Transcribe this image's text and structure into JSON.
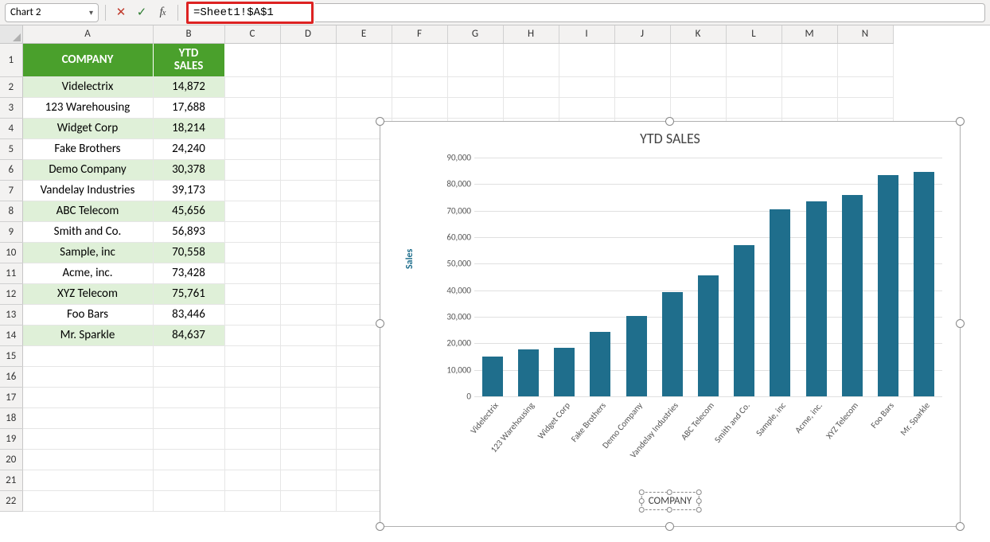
{
  "formula_bar": {
    "namebox": "Chart 2",
    "formula": "=Sheet1!$A$1"
  },
  "columns": [
    "A",
    "B",
    "C",
    "D",
    "E",
    "F",
    "G",
    "H",
    "I",
    "J",
    "K",
    "L",
    "M",
    "N"
  ],
  "table": {
    "headers": {
      "col1": "COMPANY",
      "col2": "YTD SALES"
    },
    "rows": [
      {
        "company": "Videlectrix",
        "sales": "14,872"
      },
      {
        "company": "123 Warehousing",
        "sales": "17,688"
      },
      {
        "company": "Widget Corp",
        "sales": "18,214"
      },
      {
        "company": "Fake Brothers",
        "sales": "24,240"
      },
      {
        "company": "Demo Company",
        "sales": "30,378"
      },
      {
        "company": "Vandelay Industries",
        "sales": "39,173"
      },
      {
        "company": "ABC Telecom",
        "sales": "45,656"
      },
      {
        "company": "Smith and Co.",
        "sales": "56,893"
      },
      {
        "company": "Sample, inc",
        "sales": "70,558"
      },
      {
        "company": "Acme, inc.",
        "sales": "73,428"
      },
      {
        "company": "XYZ Telecom",
        "sales": "75,761"
      },
      {
        "company": "Foo Bars",
        "sales": "83,446"
      },
      {
        "company": "Mr. Sparkle",
        "sales": "84,637"
      }
    ]
  },
  "chart_data": {
    "type": "bar",
    "title": "YTD SALES",
    "ylabel": "Sales",
    "legend": "COMPANY",
    "ylim": [
      0,
      90000
    ],
    "yticks": [
      "0",
      "10,000",
      "20,000",
      "30,000",
      "40,000",
      "50,000",
      "60,000",
      "70,000",
      "80,000",
      "90,000"
    ],
    "categories": [
      "Videlectrix",
      "123 Warehousing",
      "Widget Corp",
      "Fake Brothers",
      "Demo Company",
      "Vandelay Industries",
      "ABC Telecom",
      "Smith and Co.",
      "Sample, inc",
      "Acme, inc.",
      "XYZ Telecom",
      "Foo Bars",
      "Mr. Sparkle"
    ],
    "values": [
      14872,
      17688,
      18214,
      24240,
      30378,
      39173,
      45656,
      56893,
      70558,
      73428,
      75761,
      83446,
      84637
    ]
  },
  "row_count": 22
}
